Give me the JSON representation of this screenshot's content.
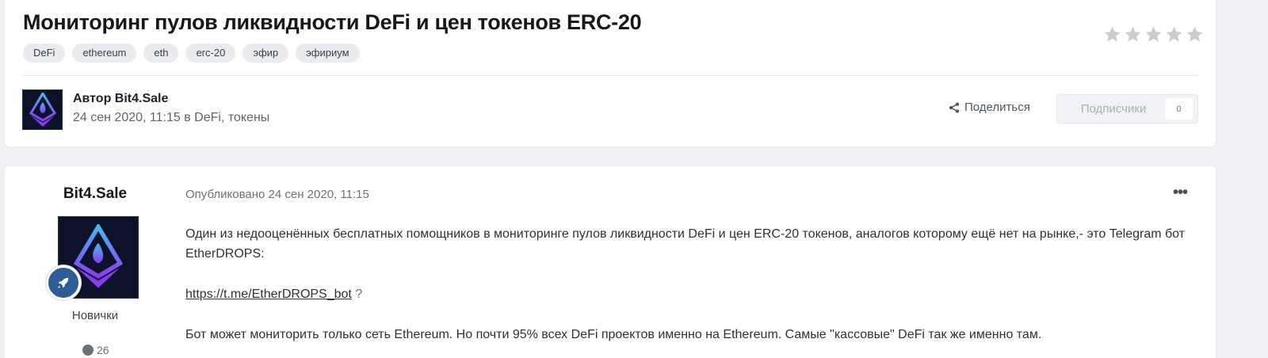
{
  "topic": {
    "title": "Мониторинг пулов ликвидности DeFi и цен токенов ERC-20",
    "tags": [
      "DeFi",
      "ethereum",
      "eth",
      "erc-20",
      "эфир",
      "эфириум"
    ],
    "rating_stars": 5
  },
  "author_bar": {
    "author_line": "Автор Bit4.Sale",
    "meta_line": "24 сен 2020, 11:15 в DeFi, токены",
    "share_label": "Поделиться",
    "followers_label": "Подписчики",
    "followers_count": "0"
  },
  "post": {
    "author_name": "Bit4.Sale",
    "rank_title": "Новички",
    "post_count": "26",
    "published": "Опубликовано 24 сен 2020, 11:15",
    "menu_label": "•••",
    "paragraph_1": "Один из недооценённых бесплатных помощников в мониторинге пулов ликвидности DeFi и цен ERC-20 токенов, аналогов которому ещё нет на рынке,- это Telegram бот EtherDROPS:",
    "link_text": "https://t.me/EtherDROPS_bot",
    "link_suffix": " ?",
    "paragraph_2": "Бот может мониторить только сеть Ethereum. Но почти 95% всех DeFi проектов именно на Ethereum. Самые \"кассовые\" DeFi так же именно там."
  },
  "colors": {
    "page_bg": "#eef0f3",
    "card_bg": "#ffffff",
    "tag_bg": "#e9ebee",
    "rank_badge": "#2e5c96",
    "star": "#c9cdd3"
  }
}
